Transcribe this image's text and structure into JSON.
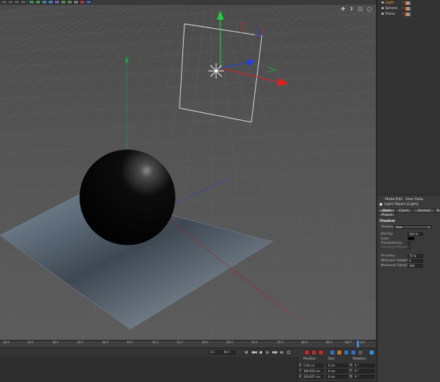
{
  "toolbar": {
    "button_count": 14
  },
  "viewport": {
    "nav_icons": "✥ ↕ ◳ ▢"
  },
  "object_manager": {
    "objects": [
      {
        "name": "Light",
        "selected": true
      },
      {
        "name": "Sphere",
        "selected": false
      },
      {
        "name": "Plane",
        "selected": false
      }
    ],
    "check_glyph": "✓"
  },
  "attribute_manager": {
    "menu": [
      "Mode",
      "Edit",
      "User Data"
    ],
    "object_title": "Light Object [Light]",
    "tabs": [
      "Basic",
      "Coord.",
      "General",
      "D"
    ],
    "project_tab": "Project",
    "section_title": "Shadow",
    "shadow": {
      "label": "Shadow",
      "value": "Area"
    },
    "fields": [
      {
        "label": "Density",
        "value": "100 %"
      },
      {
        "label": "Color",
        "value": ""
      },
      {
        "label": "Transparency",
        "value": "✓"
      },
      {
        "label": "Clipping Influence",
        "value": ""
      }
    ],
    "fields2": [
      {
        "label": "Accuracy",
        "value": "75 %"
      },
      {
        "label": "Minimum Samples",
        "value": "0"
      },
      {
        "label": "Maximum Samples",
        "value": "100"
      }
    ]
  },
  "timeline": {
    "ticks": [
      "20 F",
      "25 F",
      "30 F",
      "35 F",
      "40 F",
      "45 F",
      "50 F",
      "55 F",
      "60 F",
      "65 F",
      "70 F",
      "75 F",
      "80 F",
      "85 F",
      "90 F"
    ],
    "current_frame": "0 F"
  },
  "transport": {
    "start_field": "0 F",
    "end_field": "90 F",
    "buttons": [
      "⏮",
      "◀◀",
      "◀",
      "▶",
      "▶▶",
      "⏭",
      "◯"
    ]
  },
  "coordinates": {
    "headers": [
      "Position",
      "Size",
      "Rotation"
    ],
    "rows": [
      {
        "axis": "X",
        "position": "0.00 cm",
        "size": "0 cm",
        "rotation_axis": "H",
        "rotation": "0 °"
      },
      {
        "axis": "Y",
        "position": "300.953 cm",
        "size": "0 cm",
        "rotation_axis": "P",
        "rotation": "0 °"
      },
      {
        "axis": "Z",
        "position": "203.657 cm",
        "size": "0 cm",
        "rotation_axis": "B",
        "rotation": "0 °"
      }
    ]
  },
  "colors": {
    "axis_x": "#e02020",
    "axis_y": "#20d040",
    "axis_z": "#2040e0",
    "selection": "#f0a030",
    "accent_blue": "#3b8fd8"
  }
}
